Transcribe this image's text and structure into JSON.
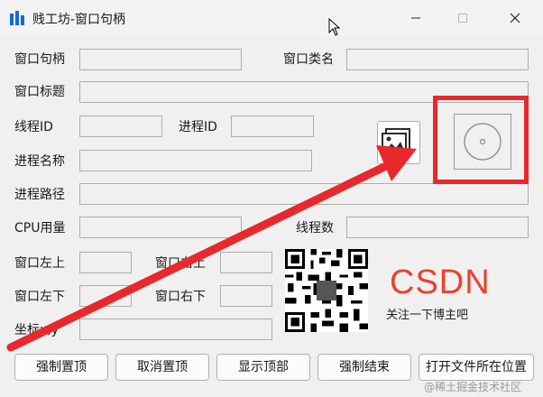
{
  "window": {
    "title": "贱工坊-窗口句柄",
    "accent": "#e8282b"
  },
  "labels": {
    "handle": "窗口句柄",
    "class_name": "窗口类名",
    "title": "窗口标题",
    "thread_id": "线程ID",
    "process_id": "进程ID",
    "process_name": "进程名称",
    "process_path": "进程路径",
    "cpu": "CPU用量",
    "thread_count": "线程数",
    "top_left": "窗口左上",
    "top_right": "窗口右上",
    "bottom_left": "窗口左下",
    "bottom_right": "窗口右下",
    "coords": "坐标x,y"
  },
  "fields": {
    "handle": "",
    "class_name": "",
    "title": "",
    "thread_id": "",
    "process_id": "",
    "process_name": "",
    "process_path": "",
    "cpu": "",
    "thread_count": "",
    "top_left": "",
    "top_right": "",
    "bottom_left": "",
    "bottom_right": "",
    "coords": ""
  },
  "buttons": {
    "force_top": "强制置顶",
    "cancel_top": "取消置顶",
    "show_top": "显示顶部",
    "force_close": "强制结束",
    "open_location": "打开文件所在位置"
  },
  "promo": {
    "logo": "CSDN",
    "follow": "关注一下博主吧",
    "watermark": "@稀土掘金技术社区"
  },
  "icons": {
    "app": "app-bars-icon",
    "image_button": "image-icon",
    "target": "crosshair-target-icon"
  }
}
